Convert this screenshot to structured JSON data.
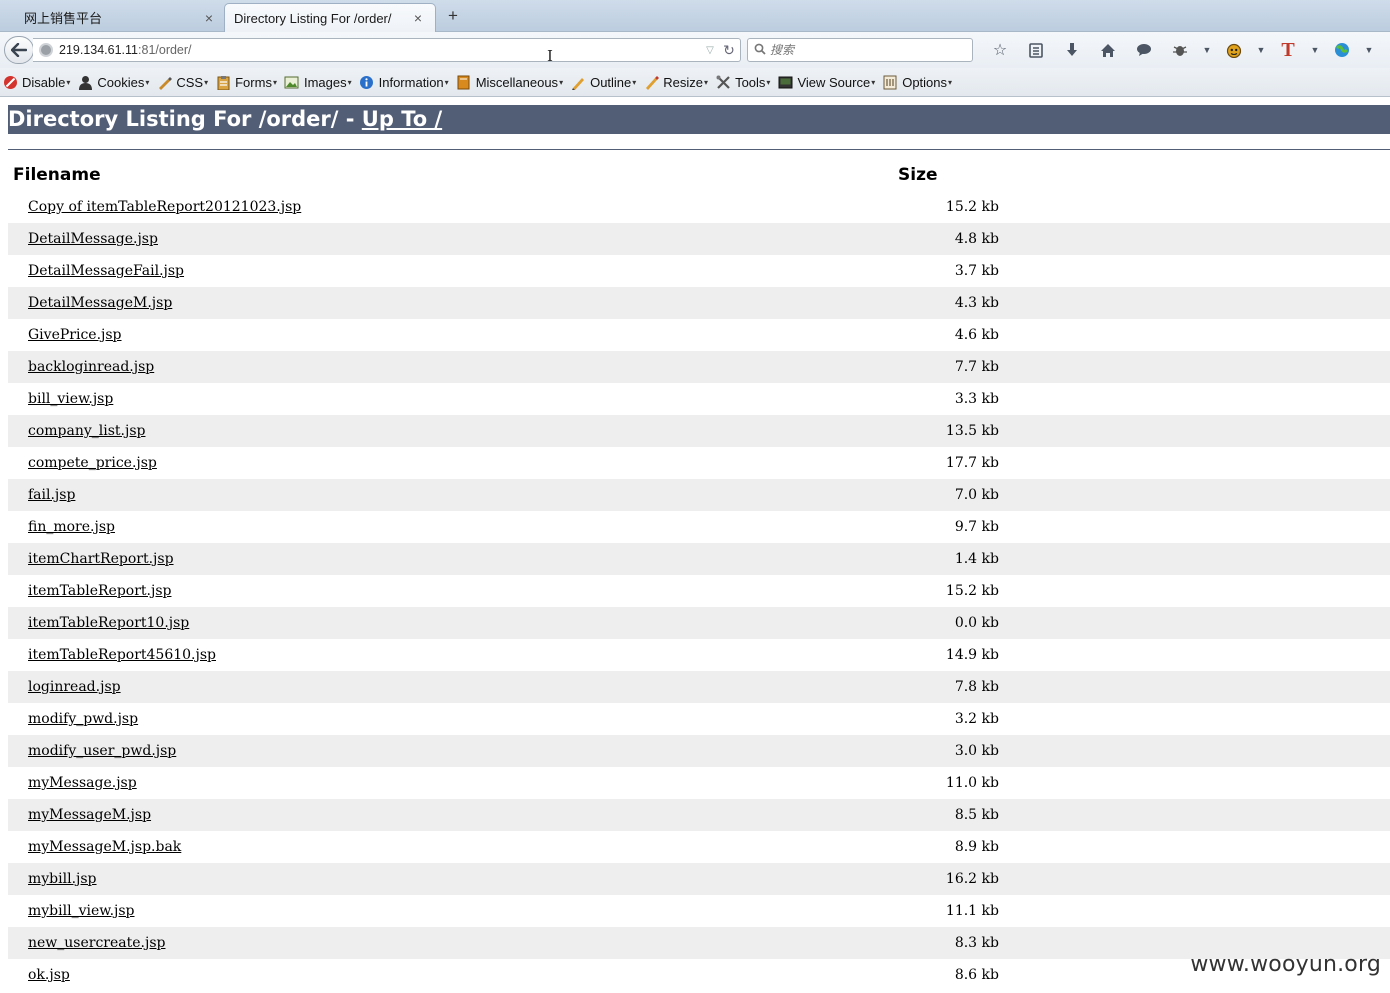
{
  "browser": {
    "tabs": [
      {
        "title": "网上销售平台",
        "active": false
      },
      {
        "title": "Directory Listing For /order/",
        "active": true
      }
    ],
    "url_host": "219.134.61.11",
    "url_rest": ":81/order/",
    "search_placeholder": "搜索"
  },
  "devtoolbar": {
    "items": [
      {
        "label": "Disable",
        "icon": "disable-icon"
      },
      {
        "label": "Cookies",
        "icon": "cookies-icon"
      },
      {
        "label": "CSS",
        "icon": "css-icon"
      },
      {
        "label": "Forms",
        "icon": "forms-icon"
      },
      {
        "label": "Images",
        "icon": "images-icon"
      },
      {
        "label": "Information",
        "icon": "information-icon"
      },
      {
        "label": "Miscellaneous",
        "icon": "miscellaneous-icon"
      },
      {
        "label": "Outline",
        "icon": "outline-icon"
      },
      {
        "label": "Resize",
        "icon": "resize-icon"
      },
      {
        "label": "Tools",
        "icon": "tools-icon"
      },
      {
        "label": "View Source",
        "icon": "view-source-icon"
      },
      {
        "label": "Options",
        "icon": "options-icon"
      }
    ]
  },
  "page": {
    "heading_prefix": "Directory Listing For /order/ - ",
    "heading_link": "Up To /",
    "columns": {
      "filename": "Filename",
      "size": "Size"
    },
    "files": [
      {
        "name": "Copy of itemTableReport20121023.jsp",
        "size": "15.2 kb"
      },
      {
        "name": "DetailMessage.jsp",
        "size": "4.8 kb"
      },
      {
        "name": "DetailMessageFail.jsp",
        "size": "3.7 kb"
      },
      {
        "name": "DetailMessageM.jsp",
        "size": "4.3 kb"
      },
      {
        "name": "GivePrice.jsp",
        "size": "4.6 kb"
      },
      {
        "name": "backloginread.jsp",
        "size": "7.7 kb"
      },
      {
        "name": "bill_view.jsp",
        "size": "3.3 kb"
      },
      {
        "name": "company_list.jsp",
        "size": "13.5 kb"
      },
      {
        "name": "compete_price.jsp",
        "size": "17.7 kb"
      },
      {
        "name": "fail.jsp",
        "size": "7.0 kb"
      },
      {
        "name": "fin_more.jsp",
        "size": "9.7 kb"
      },
      {
        "name": "itemChartReport.jsp",
        "size": "1.4 kb"
      },
      {
        "name": "itemTableReport.jsp",
        "size": "15.2 kb"
      },
      {
        "name": "itemTableReport10.jsp",
        "size": "0.0 kb"
      },
      {
        "name": "itemTableReport45610.jsp",
        "size": "14.9 kb"
      },
      {
        "name": "loginread.jsp",
        "size": "7.8 kb"
      },
      {
        "name": "modify_pwd.jsp",
        "size": "3.2 kb"
      },
      {
        "name": "modify_user_pwd.jsp",
        "size": "3.0 kb"
      },
      {
        "name": "myMessage.jsp",
        "size": "11.0 kb"
      },
      {
        "name": "myMessageM.jsp",
        "size": "8.5 kb"
      },
      {
        "name": "myMessageM.jsp.bak",
        "size": "8.9 kb"
      },
      {
        "name": "mybill.jsp",
        "size": "16.2 kb"
      },
      {
        "name": "mybill_view.jsp",
        "size": "11.1 kb"
      },
      {
        "name": "new_usercreate.jsp",
        "size": "8.3 kb"
      },
      {
        "name": "ok.jsp",
        "size": "8.6 kb"
      }
    ]
  },
  "watermark": "www.wooyun.org",
  "colors": {
    "heading_bg": "#525d76",
    "row_alt": "#eeeeee"
  }
}
